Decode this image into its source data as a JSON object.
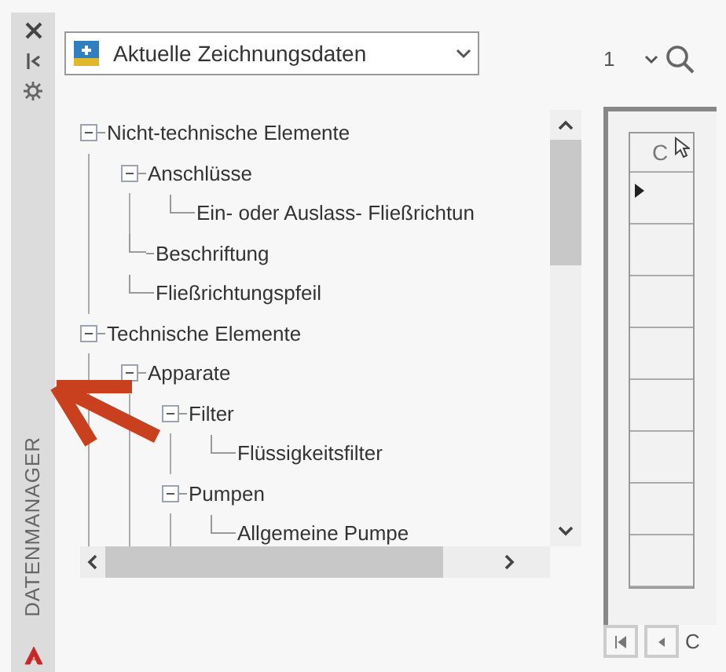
{
  "sidebar": {
    "title": "DATENMANAGER"
  },
  "view_select": {
    "value": "Aktuelle Zeichnungsdaten"
  },
  "tree": [
    {
      "label": "Nicht-technische Elemente",
      "expanded": true,
      "children": [
        {
          "label": "Anschlüsse",
          "expanded": true,
          "children": [
            {
              "label": "Ein- oder Auslass- Fließrichtun"
            }
          ]
        },
        {
          "label": "Beschriftung"
        },
        {
          "label": "Fließrichtungspfeil"
        }
      ]
    },
    {
      "label": "Technische Elemente",
      "expanded": true,
      "children": [
        {
          "label": "Apparate",
          "expanded": true,
          "children": [
            {
              "label": "Filter",
              "expanded": true,
              "children": [
                {
                  "label": "Flüssigkeitsfilter"
                }
              ]
            },
            {
              "label": "Pumpen",
              "expanded": true,
              "children": [
                {
                  "label": "Allgemeine Pumpe"
                }
              ]
            }
          ]
        }
      ]
    }
  ],
  "grid": {
    "selector_value": "1",
    "column_header": "C",
    "rows": [
      {
        "current": true
      },
      {
        "current": false
      },
      {
        "current": false
      },
      {
        "current": false
      },
      {
        "current": false
      },
      {
        "current": false
      },
      {
        "current": false
      },
      {
        "current": false
      }
    ]
  },
  "navigator": {
    "label": "C"
  }
}
